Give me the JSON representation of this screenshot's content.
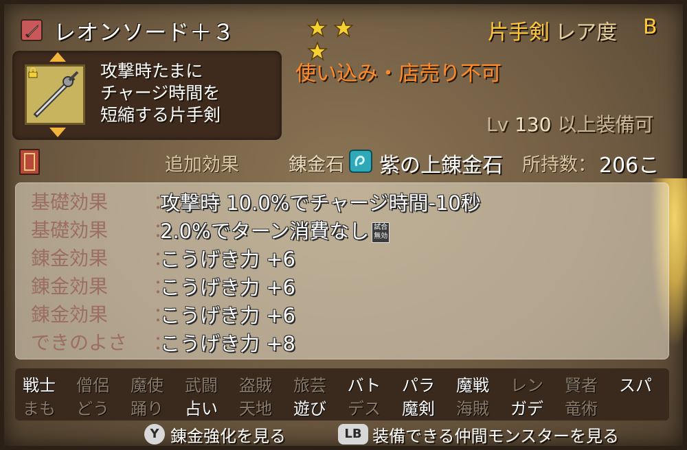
{
  "header": {
    "item_name": "レオンソード＋３",
    "star_count": 3,
    "weapon_type": "片手剣",
    "rarity_label": "レア度",
    "rarity_value": "B"
  },
  "description": {
    "text": "攻撃時たまに\nチャージ時間を\n短縮する片手剣",
    "restriction": "使い込み・店売り不可",
    "level_prefix": "Lv",
    "level_value": "130",
    "level_suffix": "以上装備可"
  },
  "alchemy": {
    "extra_effect_label": "追加効果",
    "stone_label": "錬金石",
    "stone_name": "紫の上錬金石",
    "owned_label": "所持数：",
    "owned_value": "206こ"
  },
  "effects": [
    {
      "label": "基礎効果",
      "colon": "：",
      "value": "攻撃時 10.0%でチャージ時間-10秒",
      "badge": ""
    },
    {
      "label": "基礎効果",
      "colon": "：",
      "value": "2.0%でターン消費なし",
      "badge": "試合\n無効"
    },
    {
      "label": "錬金効果",
      "colon": "：",
      "value": "こうげき力 +6",
      "badge": ""
    },
    {
      "label": "錬金効果",
      "colon": "：",
      "value": "こうげき力 +6",
      "badge": ""
    },
    {
      "label": "錬金効果",
      "colon": "：",
      "value": "こうげき力 +6",
      "badge": ""
    },
    {
      "label": "できのよさ",
      "colon": "：",
      "value": "こうげき力 +8",
      "badge": ""
    }
  ],
  "jobs_row1": [
    {
      "name": "戦士",
      "enabled": true
    },
    {
      "name": "僧侶",
      "enabled": false
    },
    {
      "name": "魔使",
      "enabled": false
    },
    {
      "name": "武闘",
      "enabled": false
    },
    {
      "name": "盗賊",
      "enabled": false
    },
    {
      "name": "旅芸",
      "enabled": false
    },
    {
      "name": "バト",
      "enabled": true
    },
    {
      "name": "パラ",
      "enabled": true
    },
    {
      "name": "魔戦",
      "enabled": true
    },
    {
      "name": "レン",
      "enabled": false
    },
    {
      "name": "賢者",
      "enabled": false
    },
    {
      "name": "スパ",
      "enabled": true
    }
  ],
  "jobs_row2": [
    {
      "name": "まも",
      "enabled": false
    },
    {
      "name": "どう",
      "enabled": false
    },
    {
      "name": "踊り",
      "enabled": false
    },
    {
      "name": "占い",
      "enabled": true
    },
    {
      "name": "天地",
      "enabled": false
    },
    {
      "name": "遊び",
      "enabled": true
    },
    {
      "name": "デス",
      "enabled": false
    },
    {
      "name": "魔剣",
      "enabled": true
    },
    {
      "name": "海賊",
      "enabled": false
    },
    {
      "name": "ガデ",
      "enabled": true
    },
    {
      "name": "竜術",
      "enabled": false
    }
  ],
  "footer": {
    "y_button": "Y",
    "y_label": "錬金強化を見る",
    "lb_button": "LB",
    "lb_label": "装備できる仲間モンスターを見る"
  },
  "colors": {
    "gold": "#ffc93a",
    "restriction": "#ff8a2a",
    "effect_label": "#9b6d63",
    "job_on": "#ffffff",
    "job_off": "#8a7b68"
  },
  "icons": {
    "header": "sword-icon",
    "item": "leon-sword-icon",
    "lock": "lock-icon",
    "book": "book-icon",
    "stone": "alchemy-stone-icon",
    "star": "star-icon"
  }
}
